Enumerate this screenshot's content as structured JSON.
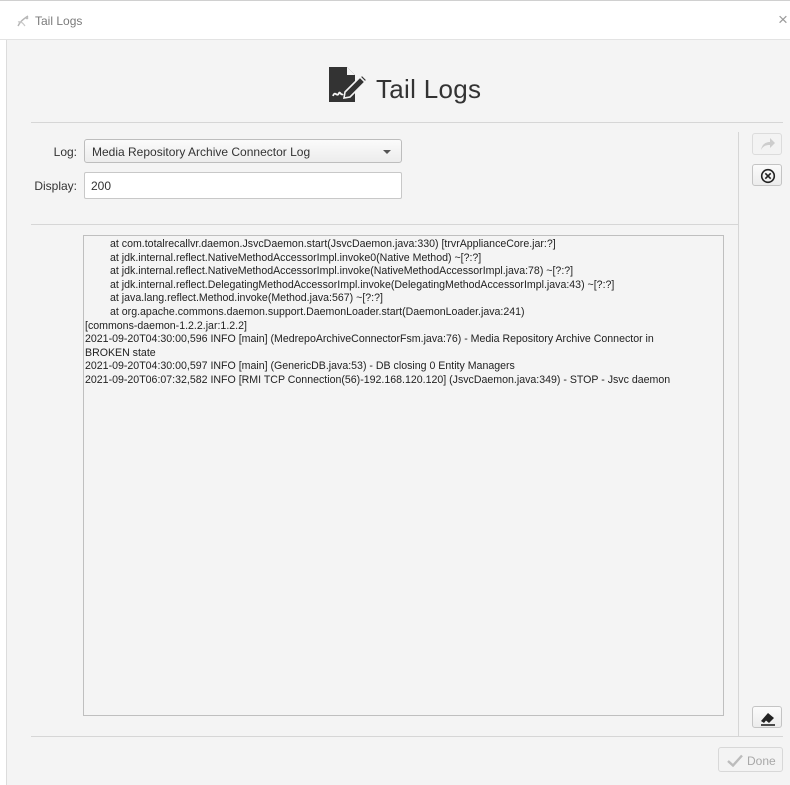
{
  "window": {
    "title": "Tail Logs",
    "close_glyph": "×"
  },
  "header": {
    "title": "Tail Logs",
    "icon": "edit-document-icon"
  },
  "form": {
    "log_label": "Log:",
    "log_selected": "Media Repository Archive Connector Log",
    "display_label": "Display:",
    "display_value": "200"
  },
  "log": {
    "lines": [
      {
        "text": "at com.totalrecallvr.daemon.JsvcDaemon.start(JsvcDaemon.java:330) [trvrApplianceCore.jar:?]",
        "indent": true
      },
      {
        "text": "at jdk.internal.reflect.NativeMethodAccessorImpl.invoke0(Native Method) ~[?:?]",
        "indent": true
      },
      {
        "text": "at jdk.internal.reflect.NativeMethodAccessorImpl.invoke(NativeMethodAccessorImpl.java:78) ~[?:?]",
        "indent": true
      },
      {
        "text": "at jdk.internal.reflect.DelegatingMethodAccessorImpl.invoke(DelegatingMethodAccessorImpl.java:43) ~[?:?]",
        "indent": true
      },
      {
        "text": "at java.lang.reflect.Method.invoke(Method.java:567) ~[?:?]",
        "indent": true
      },
      {
        "text": "at org.apache.commons.daemon.support.DaemonLoader.start(DaemonLoader.java:241)",
        "indent": true
      },
      {
        "text": "[commons-daemon-1.2.2.jar:1.2.2]",
        "indent": false
      },
      {
        "text": "2021-09-20T04:30:00,596  INFO [main] (MedrepoArchiveConnectorFsm.java:76) - Media Repository Archive Connector in",
        "indent": false
      },
      {
        "text": "BROKEN state",
        "indent": false
      },
      {
        "text": "2021-09-20T04:30:00,597  INFO [main] (GenericDB.java:53) - DB closing 0 Entity Managers",
        "indent": false
      },
      {
        "text": "2021-09-20T06:07:32,582  INFO [RMI TCP Connection(56)-192.168.120.120] (JsvcDaemon.java:349) - STOP - Jsvc daemon",
        "indent": false
      }
    ]
  },
  "side_buttons": {
    "share": {
      "icon": "share-arrow-icon",
      "enabled": false
    },
    "close_log": {
      "icon": "circle-x-icon",
      "enabled": true
    },
    "clear": {
      "icon": "eraser-icon",
      "enabled": true
    }
  },
  "footer": {
    "done_label": "Done",
    "done_icon": "check-icon",
    "done_enabled": false
  },
  "colors": {
    "dialog_bg": "#f4f4f4",
    "border": "#bfbfbf",
    "text": "#222222",
    "disabled_text": "#a8a8a8"
  }
}
